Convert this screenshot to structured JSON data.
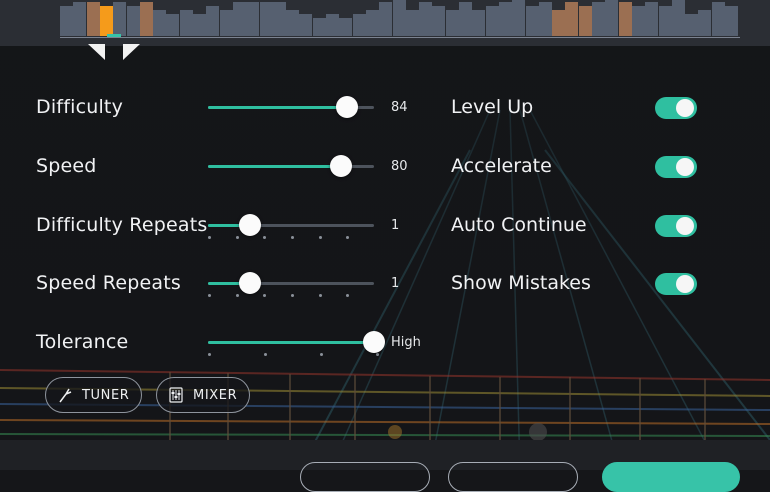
{
  "settings": [
    {
      "label": "Difficulty",
      "value": 84,
      "value_label": "84"
    },
    {
      "label": "Speed",
      "value": 80,
      "value_label": "80"
    },
    {
      "label": "Difficulty Repeats",
      "value": 1,
      "value_label": "1"
    },
    {
      "label": "Speed Repeats",
      "value": 1,
      "value_label": "1"
    },
    {
      "label": "Tolerance",
      "value": 1.0,
      "value_label": "High"
    }
  ],
  "toggles": [
    {
      "label": "Level Up",
      "on": true
    },
    {
      "label": "Accelerate",
      "on": true
    },
    {
      "label": "Auto Continue",
      "on": true
    },
    {
      "label": "Show Mistakes",
      "on": true
    }
  ],
  "buttons": {
    "tuner": "TUNER",
    "mixer": "MIXER"
  },
  "colors": {
    "accent": "#2fbfa0",
    "timeline_highlight": "#9b6f52",
    "timeline_current": "#f59b1b",
    "timeline_bar": "#566070"
  },
  "icons": {
    "tuner": "tuning-fork-icon",
    "mixer": "mixer-sliders-icon",
    "pointer": "playhead-pointer-icon"
  }
}
